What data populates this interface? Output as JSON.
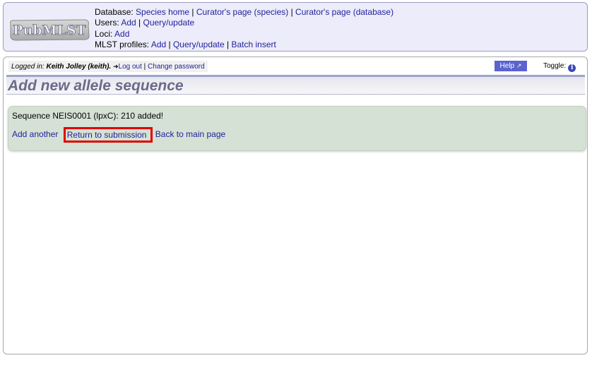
{
  "header": {
    "logo_text": "PubMLST",
    "database": {
      "label": "Database:",
      "links": [
        "Species home",
        "Curator's page (species)",
        "Curator's page (database)"
      ]
    },
    "users": {
      "label": "Users:",
      "links": [
        "Add",
        "Query/update"
      ]
    },
    "loci": {
      "label": "Loci:",
      "links": [
        "Add"
      ]
    },
    "mlst": {
      "label": "MLST profiles:",
      "links": [
        "Add",
        "Query/update",
        "Batch insert"
      ]
    },
    "separator": " | "
  },
  "topbar": {
    "logged_in_label": "Logged in:",
    "user": "Keith Jolley (keith).",
    "logout": "Log out",
    "change_password": "Change password",
    "help": "Help",
    "toggle": "Toggle:",
    "toggle_icon": "info-icon"
  },
  "page": {
    "title": "Add new allele sequence",
    "status_message": "Sequence NEIS0001 (lpxC): 210 added!",
    "links": {
      "add_another": "Add another",
      "return_submission": "Return to submission",
      "back_main": "Back to main page"
    }
  },
  "colors": {
    "header_bg": "#ececfa",
    "status_bg": "#d5e1d5",
    "help_bg": "#5b63cf",
    "highlight": "#e00000",
    "title": "#6a6a8a"
  }
}
